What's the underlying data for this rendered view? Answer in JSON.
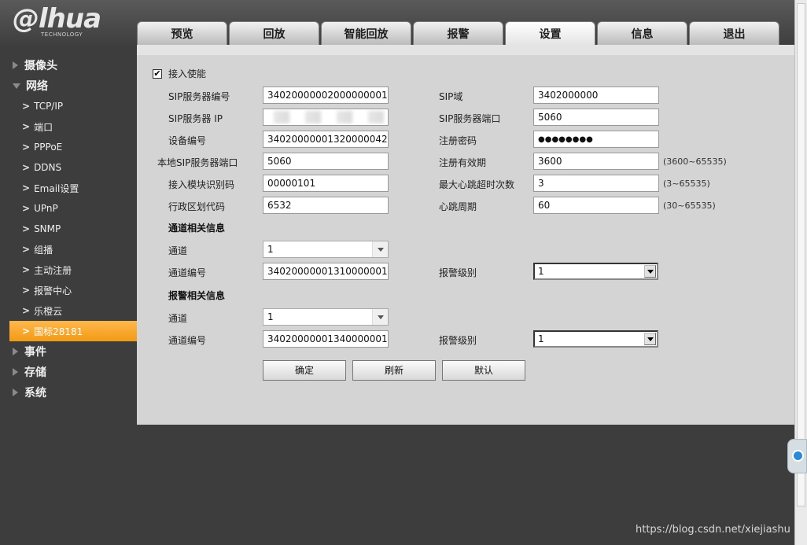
{
  "logo": {
    "main": "@lhua",
    "sub": "TECHNOLOGY"
  },
  "tabs": [
    {
      "label": "预览",
      "active": false
    },
    {
      "label": "回放",
      "active": false
    },
    {
      "label": "智能回放",
      "active": false
    },
    {
      "label": "报警",
      "active": false
    },
    {
      "label": "设置",
      "active": true
    },
    {
      "label": "信息",
      "active": false
    },
    {
      "label": "退出",
      "active": false
    }
  ],
  "sidebar": {
    "top_items": {
      "camera": "摄像头",
      "network": "网络",
      "event": "事件",
      "storage": "存储",
      "system": "系统"
    },
    "network_items": [
      {
        "label": "TCP/IP"
      },
      {
        "label": "端口"
      },
      {
        "label": "PPPoE"
      },
      {
        "label": "DDNS"
      },
      {
        "label": "Email设置"
      },
      {
        "label": "UPnP"
      },
      {
        "label": "SNMP"
      },
      {
        "label": "组播"
      },
      {
        "label": "主动注册"
      },
      {
        "label": "报警中心"
      },
      {
        "label": "乐橙云"
      },
      {
        "label": "国标28181",
        "selected": true
      }
    ]
  },
  "form": {
    "enable_label": "接入使能",
    "enable_checked": "✔",
    "left": {
      "sip_server_id_label": "SIP服务器编号",
      "sip_server_id": "34020000002000000001",
      "sip_server_ip_label": "SIP服务器 IP",
      "device_id_label": "设备编号",
      "device_id": "34020000001320000042",
      "local_sip_port_label": "本地SIP服务器端口",
      "local_sip_port": "5060",
      "module_id_label": "接入模块识别码",
      "module_id": "00000101",
      "region_code_label": "行政区划代码",
      "region_code": "6532"
    },
    "right": {
      "sip_domain_label": "SIP域",
      "sip_domain": "3402000000",
      "sip_server_port_label": "SIP服务器端口",
      "sip_server_port": "5060",
      "reg_password_label": "注册密码",
      "reg_password": "●●●●●●●●",
      "reg_valid_label": "注册有效期",
      "reg_valid": "3600",
      "reg_valid_hint": "(3600~65535)",
      "heartbeat_timeout_label": "最大心跳超时次数",
      "heartbeat_timeout": "3",
      "heartbeat_timeout_hint": "(3~65535)",
      "heartbeat_period_label": "心跳周期",
      "heartbeat_period": "60",
      "heartbeat_period_hint": "(30~65535)"
    },
    "channel_section": {
      "title": "通道相关信息",
      "channel_label": "通道",
      "channel_value": "1",
      "channel_id_label": "通道编号",
      "channel_id": "34020000001310000001",
      "alarm_level_label": "报警级别",
      "alarm_level": "1"
    },
    "alarm_section": {
      "title": "报警相关信息",
      "channel_label": "通道",
      "channel_value": "1",
      "channel_id_label": "通道编号",
      "channel_id": "34020000001340000001",
      "alarm_level_label": "报警级别",
      "alarm_level": "1"
    },
    "buttons": {
      "ok": "确定",
      "refresh": "刷新",
      "default": "默认"
    }
  },
  "watermark": "https://blog.csdn.net/xiejiashu"
}
